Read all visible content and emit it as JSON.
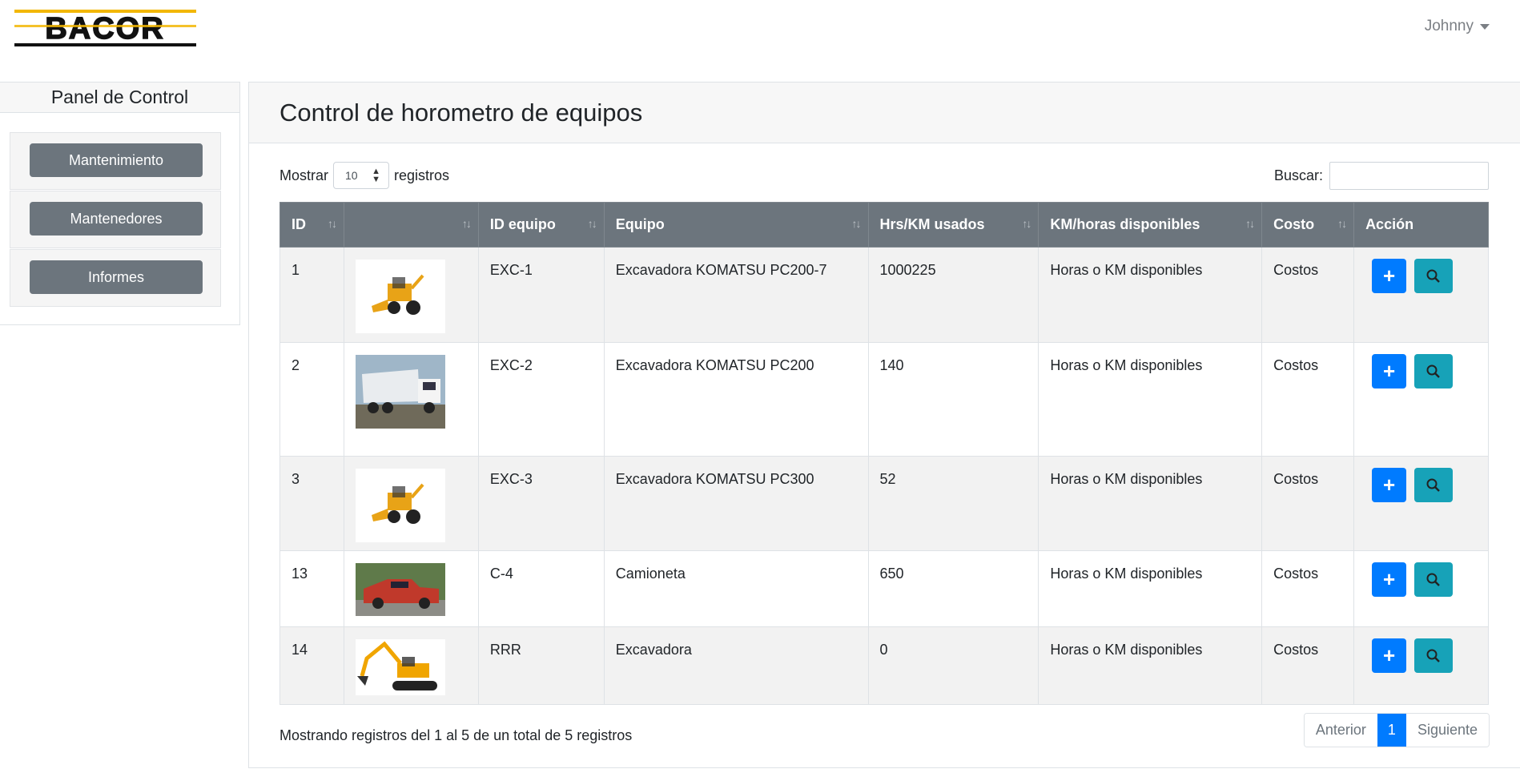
{
  "brand": {
    "logo_text": "BACOR"
  },
  "user_menu": {
    "name": "Johnny"
  },
  "sidebar": {
    "title": "Panel de Control",
    "items": [
      {
        "label": "Mantenimiento"
      },
      {
        "label": "Mantenedores"
      },
      {
        "label": "Informes"
      }
    ]
  },
  "main": {
    "title": "Control de horometro de equipos",
    "length": {
      "prefix": "Mostrar",
      "value": "10",
      "suffix": "registros"
    },
    "search": {
      "label": "Buscar:",
      "value": "",
      "placeholder": ""
    },
    "columns": [
      "ID",
      "",
      "ID equipo",
      "Equipo",
      "Hrs/KM usados",
      "KM/horas disponibles",
      "Costo",
      "Acción"
    ],
    "rows": [
      {
        "id": "1",
        "image": "backhoe-loader",
        "equipment_id": "EXC-1",
        "equipment": "Excavadora KOMATSU PC200-7",
        "used": "1000225",
        "available": "Horas o KM disponibles",
        "cost": "Costos"
      },
      {
        "id": "2",
        "image": "dump-truck",
        "equipment_id": "EXC-2",
        "equipment": "Excavadora KOMATSU PC200",
        "used": "140",
        "available": "Horas o KM disponibles",
        "cost": "Costos"
      },
      {
        "id": "3",
        "image": "backhoe-loader",
        "equipment_id": "EXC-3",
        "equipment": "Excavadora KOMATSU PC300",
        "used": "52",
        "available": "Horas o KM disponibles",
        "cost": "Costos"
      },
      {
        "id": "13",
        "image": "pickup-truck",
        "equipment_id": "C-4",
        "equipment": "Camioneta",
        "used": "650",
        "available": "Horas o KM disponibles",
        "cost": "Costos"
      },
      {
        "id": "14",
        "image": "excavator",
        "equipment_id": "RRR",
        "equipment": "Excavadora",
        "used": "0",
        "available": "Horas o KM disponibles",
        "cost": "Costos"
      }
    ],
    "actions": {
      "add_symbol": "+",
      "add_icon": "plus-icon",
      "view_icon": "search-icon"
    },
    "info": "Mostrando registros del 1 al 5 de un total de 5 registros",
    "pagination": {
      "previous": "Anterior",
      "current": "1",
      "next": "Siguiente"
    }
  },
  "colors": {
    "header_gray": "#6c757d",
    "primary_blue": "#007bff",
    "info_teal": "#17a2b8",
    "logo_yellow": "#f2b705"
  }
}
